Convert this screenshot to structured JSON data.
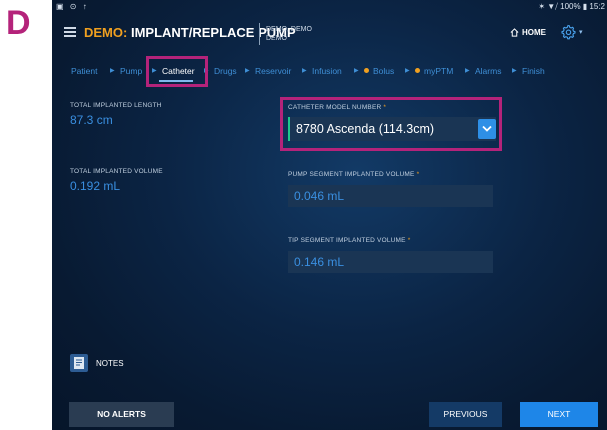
{
  "panel_letter": "D",
  "status_bar": {
    "left_icons": "▣ ⊙ ↑",
    "right_text": "✶ ▼⧸ 100% ▮ 15:2"
  },
  "header": {
    "title_prefix": "DEMO:",
    "title_main": " IMPLANT/REPLACE PUMP",
    "user_line1": "DEMO, DEMO",
    "user_line2": "DEMO",
    "home_label": "HOME"
  },
  "breadcrumbs": [
    {
      "label": "Patient",
      "dot": false,
      "active": false
    },
    {
      "label": "Pump",
      "dot": false,
      "active": false
    },
    {
      "label": "Catheter",
      "dot": false,
      "active": true
    },
    {
      "label": "Drugs",
      "dot": false,
      "active": false
    },
    {
      "label": "Reservoir",
      "dot": false,
      "active": false
    },
    {
      "label": "Infusion",
      "dot": false,
      "active": false
    },
    {
      "label": "Bolus",
      "dot": true,
      "active": false
    },
    {
      "label": "myPTM",
      "dot": true,
      "active": false
    },
    {
      "label": "Alarms",
      "dot": false,
      "active": false
    },
    {
      "label": "Finish",
      "dot": false,
      "active": false
    }
  ],
  "left_panel": {
    "total_length_label": "TOTAL IMPLANTED LENGTH",
    "total_length_value": "87.3 cm",
    "total_volume_label": "TOTAL IMPLANTED VOLUME",
    "total_volume_value": "0.192 mL"
  },
  "form": {
    "model_label": "CATHETER MODEL NUMBER",
    "model_value": "8780 Ascenda (114.3cm)",
    "pump_segment_label": "PUMP SEGMENT IMPLANTED VOLUME",
    "pump_segment_value": "0.046 mL",
    "tip_segment_label": "TIP SEGMENT IMPLANTED VOLUME",
    "tip_segment_value": "0.146 mL",
    "required_marker": "*"
  },
  "notes_label": "NOTES",
  "footer": {
    "alerts_label": "NO ALERTS",
    "previous_label": "PREVIOUS",
    "next_label": "NEXT"
  },
  "colors": {
    "highlight": "#b4237a",
    "accent_blue": "#2e8fe6",
    "demo_orange": "#f0a020",
    "valid_green": "#1ec98a"
  }
}
